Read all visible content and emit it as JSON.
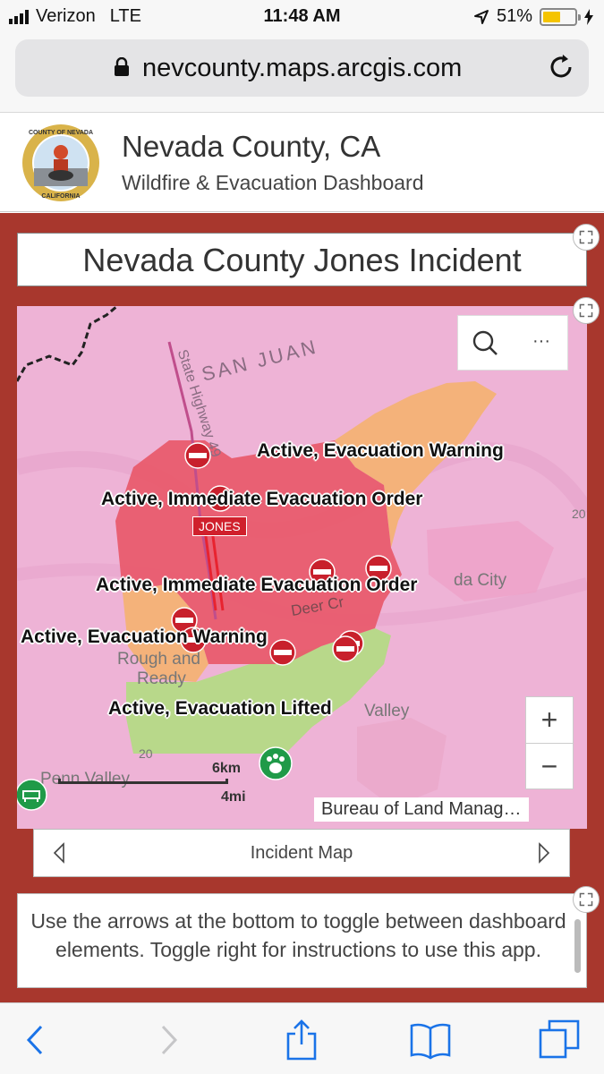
{
  "status": {
    "carrier": "Verizon",
    "network": "LTE",
    "time": "11:48 AM",
    "battery": "51%",
    "battery_level": 0.51
  },
  "browser": {
    "url": "nevcounty.maps.arcgis.com"
  },
  "header": {
    "title": "Nevada County, CA",
    "subtitle": "Wildfire & Evacuation Dashboard",
    "seal": {
      "top": "COUNTY OF NEVADA",
      "bottom": "CALIFORNIA"
    }
  },
  "dashboard": {
    "title": "Nevada County Jones Incident",
    "map": {
      "labels": {
        "warning_north": "Active, Evacuation Warning",
        "order_1": "Active, Immediate Evacuation Order",
        "order_2": "Active, Immediate Evacuation Order",
        "warning_west": "Active, Evacuation Warning",
        "lifted": "Active, Evacuation Lifted"
      },
      "incident_marker": "JONES",
      "places": {
        "san_juan": "SAN JUAN",
        "highway": "State Highway 49",
        "nevada_city": "da City",
        "deer_creek": "Deer Cr",
        "rough_ready_1": "Rough and",
        "rough_ready_2": "Ready",
        "valley": "Valley",
        "penn_valley": "Penn Valley",
        "num20a": "20",
        "num20b": "20"
      },
      "scale": {
        "km": "6km",
        "mi": "4mi"
      },
      "attribution": "Bureau of Land Manag…",
      "zoom_in": "+",
      "zoom_out": "−",
      "more": "···",
      "colors": {
        "warning": "#f4b27a",
        "order": "#e8596a",
        "lifted": "#b8d88a",
        "background": "#eeb3d6"
      }
    },
    "nav_label": "Incident Map",
    "info_text": "Use the arrows at the bottom to toggle between dashboard elements. Toggle right for instructions to use this app."
  }
}
